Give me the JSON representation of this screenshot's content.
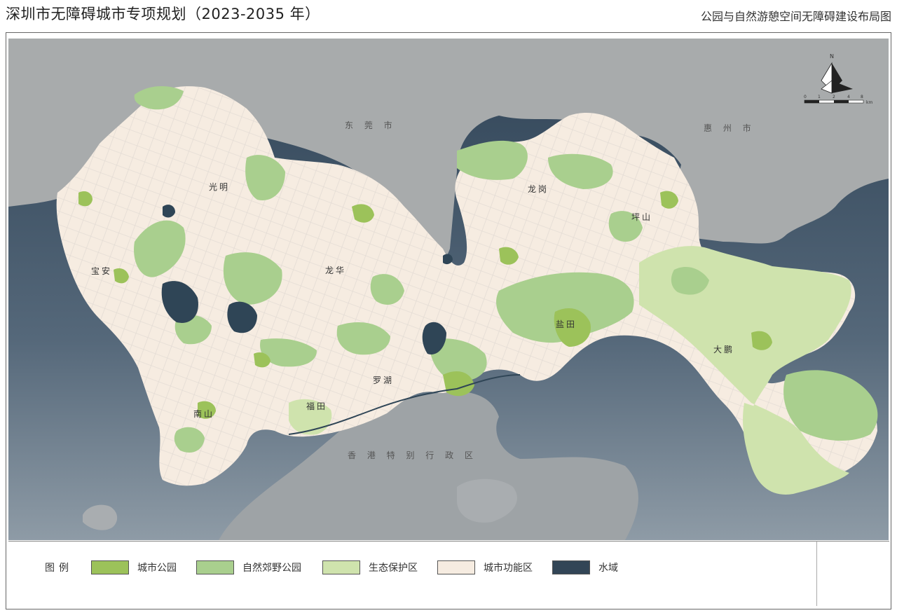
{
  "header": {
    "title": "深圳市无障碍城市专项规划（2023-2035 年）",
    "subtitle": "公园与自然游憩空间无障碍建设布局图"
  },
  "map": {
    "district_labels": [
      "光明",
      "宝安",
      "龙华",
      "南山",
      "福田",
      "罗湖",
      "龙岗",
      "坪山",
      "盐田",
      "大鹏"
    ],
    "region_labels": [
      "东 莞 市",
      "惠 州 市",
      "香 港 特 别 行 政 区"
    ],
    "north_arrow_label": "N",
    "scale_bar_ticks": [
      "0",
      "1",
      "2",
      "4",
      "8",
      "km"
    ],
    "colors": {
      "city_park": "#9cc25a",
      "country_park": "#a9cf8e",
      "eco_reserve": "#cfe3ad",
      "urban_area": "#f6ece1",
      "water": "#324556",
      "land_outside": "#a9acad",
      "road": "#d7d2cd"
    }
  },
  "legend": {
    "title": "图例",
    "items": [
      {
        "label": "城市公园",
        "color": "#9cc25a"
      },
      {
        "label": "自然郊野公园",
        "color": "#a9cf8e"
      },
      {
        "label": "生态保护区",
        "color": "#cfe3ad"
      },
      {
        "label": "城市功能区",
        "color": "#f6ece1"
      },
      {
        "label": "水域",
        "color": "#324556"
      }
    ]
  }
}
